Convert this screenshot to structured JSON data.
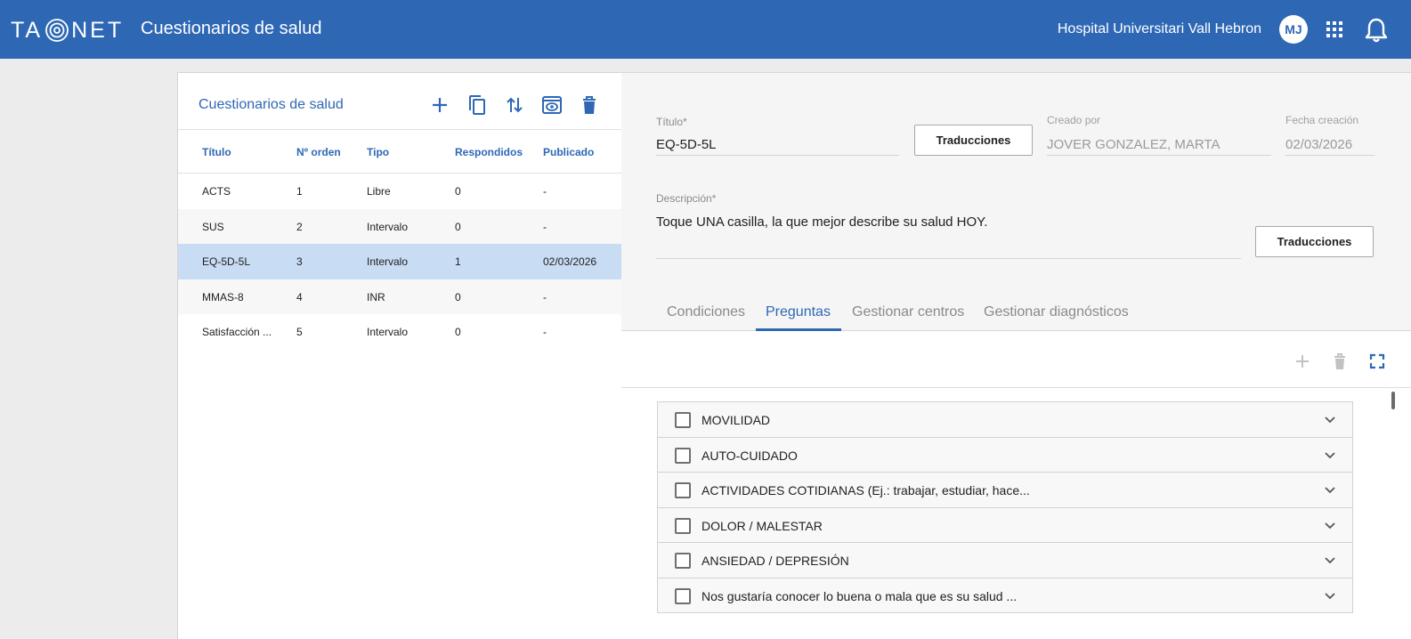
{
  "header": {
    "logo_left": "TA",
    "logo_right": "NET",
    "app_title": "Cuestionarios de salud",
    "hospital": "Hospital Universitari Vall Hebron",
    "user_initials": "MJ",
    "brand_color": "#2e68b5"
  },
  "list_panel": {
    "title": "Cuestionarios de salud",
    "toolbar_icons": [
      "add-icon",
      "copy-icon",
      "sort-icon",
      "preview-icon",
      "delete-icon"
    ],
    "columns": [
      "Título",
      "Nº orden",
      "Tipo",
      "Respondidos",
      "Publicado"
    ],
    "rows": [
      [
        "ACTS",
        "1",
        "Libre",
        "0",
        "-"
      ],
      [
        "SUS",
        "2",
        "Intervalo",
        "0",
        "-"
      ],
      [
        "EQ-5D-5L",
        "3",
        "Intervalo",
        "1",
        "02/03/2026"
      ],
      [
        "MMAS-8",
        "4",
        "INR",
        "0",
        "-"
      ],
      [
        "Satisfacción ...",
        "5",
        "Intervalo",
        "0",
        "-"
      ]
    ],
    "selected_row": 2
  },
  "detail": {
    "titulo_label": "Título*",
    "titulo_value": "EQ-5D-5L",
    "traducciones_label": "Traducciones",
    "creado_label": "Creado por",
    "creado_value": "JOVER GONZALEZ, MARTA",
    "fecha_label": "Fecha creación",
    "fecha_value": "02/03/2026",
    "descripcion_label": "Descripción*",
    "descripcion_value": "Toque UNA casilla, la que mejor describe su salud HOY.",
    "traducciones2_label": "Traducciones"
  },
  "tabs": [
    {
      "label": "Condiciones",
      "active": false
    },
    {
      "label": "Preguntas",
      "active": true
    },
    {
      "label": "Gestionar centros",
      "active": false
    },
    {
      "label": "Gestionar diagnósticos",
      "active": false
    }
  ],
  "questions_toolbar_icons": [
    "add-icon",
    "delete-icon",
    "fullscreen-icon"
  ],
  "questions": [
    "MOVILIDAD",
    "AUTO-CUIDADO",
    "ACTIVIDADES COTIDIANAS (Ej.: trabajar, estudiar, hace...",
    "DOLOR / MALESTAR",
    "ANSIEDAD / DEPRESIÓN",
    "Nos gustaría conocer lo buena o mala que es su salud ..."
  ]
}
